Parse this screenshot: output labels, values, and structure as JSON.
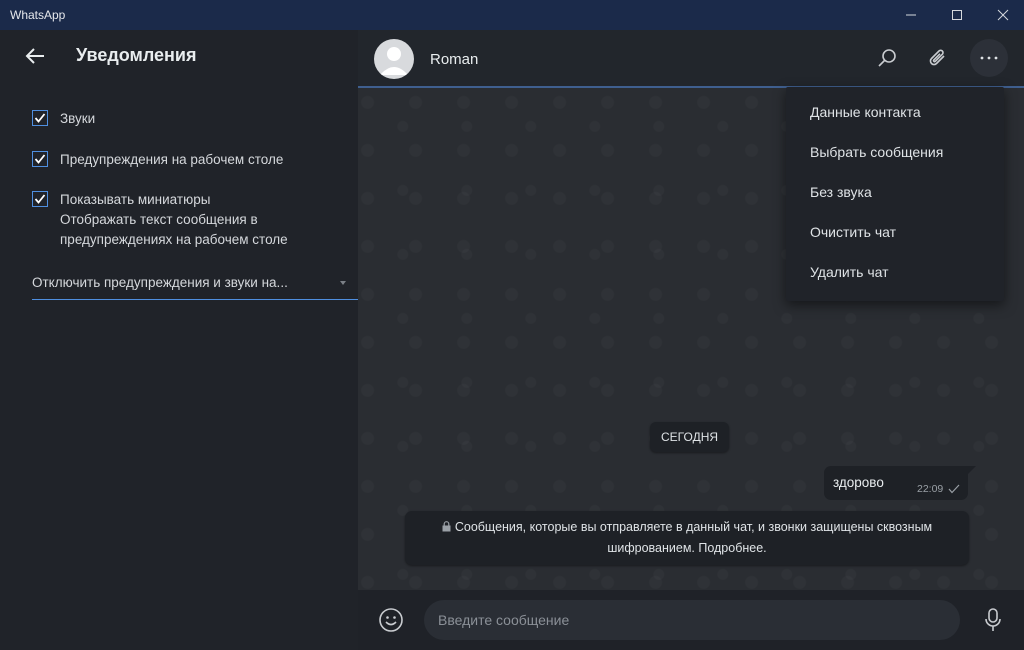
{
  "window": {
    "title": "WhatsApp"
  },
  "settings": {
    "title": "Уведомления",
    "checkboxes": [
      {
        "label": "Звуки",
        "checked": true
      },
      {
        "label": "Предупреждения на рабочем столе",
        "checked": true
      },
      {
        "label": "Показывать миниатюры",
        "checked": true
      }
    ],
    "thumbnail_desc_line1": "Отображать текст сообщения в",
    "thumbnail_desc_line2": "предупреждениях на рабочем столе",
    "mute_dropdown": "Отключить предупреждения и звуки на..."
  },
  "chat": {
    "contact_name": "Roman",
    "date_chip": "СЕГОДНЯ",
    "messages": [
      {
        "text": "здорово",
        "time": "22:09",
        "status": "sent"
      }
    ],
    "encryption_line1": "Сообщения, которые вы отправляете в данный чат, и звонки защищены сквозным",
    "encryption_line2": "шифрованием. Подробнее."
  },
  "context_menu": {
    "items": [
      "Данные контакта",
      "Выбрать сообщения",
      "Без звука",
      "Очистить чат",
      "Удалить чат"
    ]
  },
  "composer": {
    "placeholder": "Введите сообщение"
  },
  "icons": [
    "back-arrow-icon",
    "search-icon",
    "paperclip-icon",
    "more-icon",
    "emoji-icon",
    "mic-icon",
    "lock-icon",
    "check-icon"
  ],
  "colors": {
    "accent": "#4f8fe0",
    "titlebar": "#1b2a4a",
    "panel": "#202329",
    "chat_bg": "#2a2d32"
  }
}
